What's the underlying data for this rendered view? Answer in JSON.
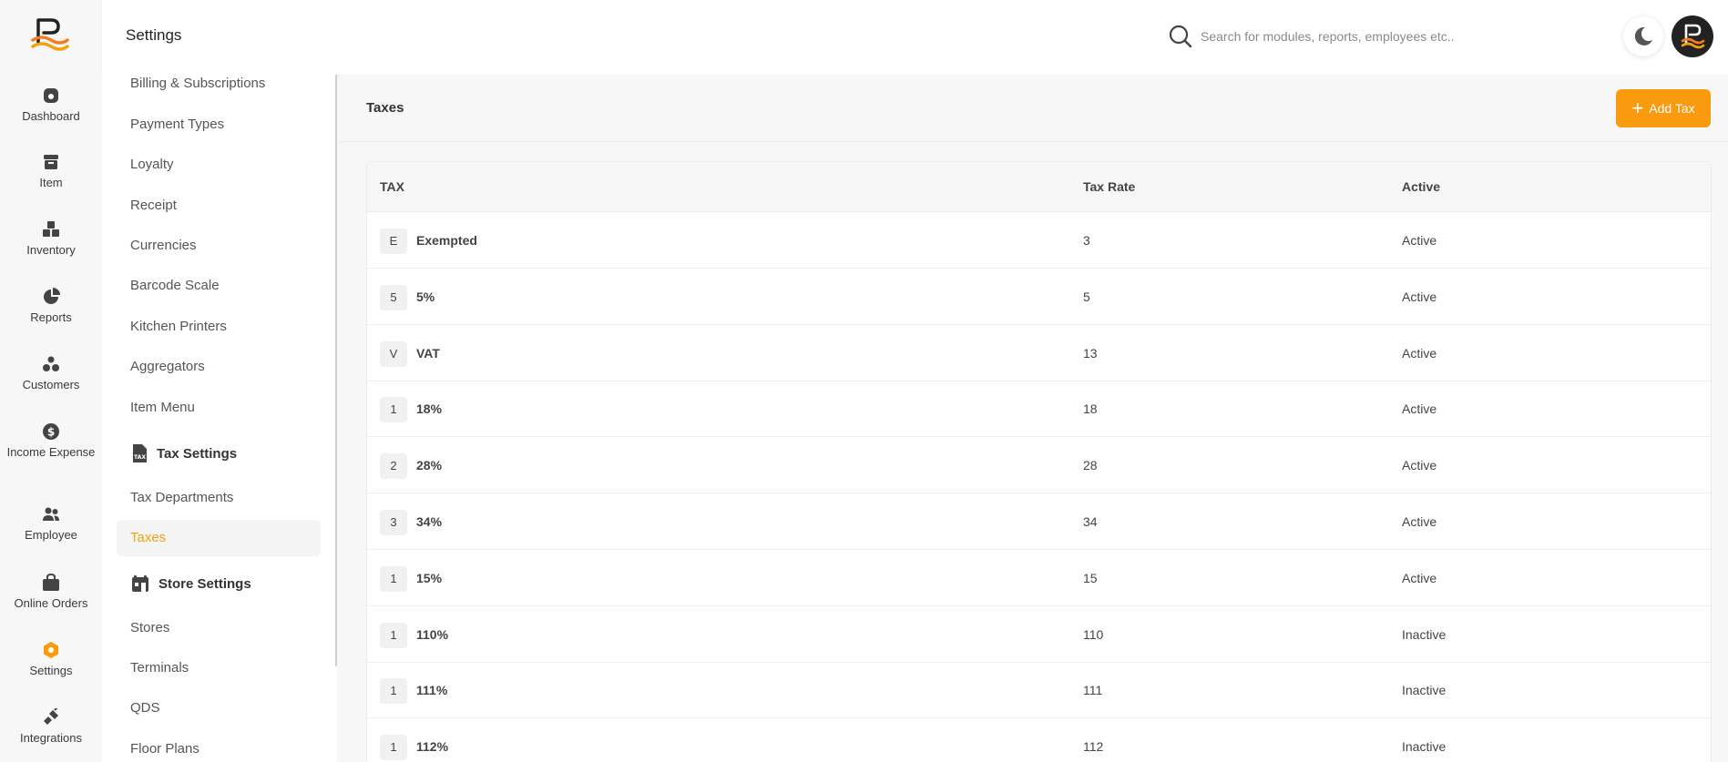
{
  "app": {
    "title": "Settings",
    "accent": "#fa9a0e"
  },
  "search": {
    "placeholder": "Search for modules, reports, employees etc.."
  },
  "rail": [
    {
      "label": "Dashboard",
      "icon": "dashboard-icon"
    },
    {
      "label": "Item",
      "icon": "item-icon"
    },
    {
      "label": "Inventory",
      "icon": "inventory-icon"
    },
    {
      "label": "Reports",
      "icon": "reports-icon"
    },
    {
      "label": "Customers",
      "icon": "customers-icon"
    },
    {
      "label": "Income Expense",
      "icon": "income-expense-icon"
    },
    {
      "label": "Employee",
      "icon": "employee-icon"
    },
    {
      "label": "Online Orders",
      "icon": "online-orders-icon"
    },
    {
      "label": "Settings",
      "icon": "settings-icon"
    },
    {
      "label": "Integrations",
      "icon": "integrations-icon"
    }
  ],
  "settings_nav": {
    "items_top": [
      "Billing & Subscriptions",
      "Payment Types",
      "Loyalty",
      "Receipt",
      "Currencies",
      "Barcode Scale",
      "Kitchen Printers",
      "Aggregators",
      "Item Menu"
    ],
    "tax_header": "Tax Settings",
    "tax_items": [
      "Tax Departments",
      "Taxes"
    ],
    "store_header": "Store Settings",
    "store_items": [
      "Stores",
      "Terminals",
      "QDS",
      "Floor Plans"
    ]
  },
  "main": {
    "title": "Taxes",
    "add_button": "Add Tax",
    "columns": [
      "TAX",
      "Tax Rate",
      "Active"
    ],
    "rows": [
      {
        "badge": "E",
        "name": "Exempted",
        "rate": "3",
        "status": "Active"
      },
      {
        "badge": "5",
        "name": "5%",
        "rate": "5",
        "status": "Active"
      },
      {
        "badge": "V",
        "name": "VAT",
        "rate": "13",
        "status": "Active"
      },
      {
        "badge": "1",
        "name": "18%",
        "rate": "18",
        "status": "Active"
      },
      {
        "badge": "2",
        "name": "28%",
        "rate": "28",
        "status": "Active"
      },
      {
        "badge": "3",
        "name": "34%",
        "rate": "34",
        "status": "Active"
      },
      {
        "badge": "1",
        "name": "15%",
        "rate": "15",
        "status": "Active"
      },
      {
        "badge": "1",
        "name": "110%",
        "rate": "110",
        "status": "Inactive"
      },
      {
        "badge": "1",
        "name": "111%",
        "rate": "111",
        "status": "Inactive"
      },
      {
        "badge": "1",
        "name": "112%",
        "rate": "112",
        "status": "Inactive"
      }
    ]
  }
}
